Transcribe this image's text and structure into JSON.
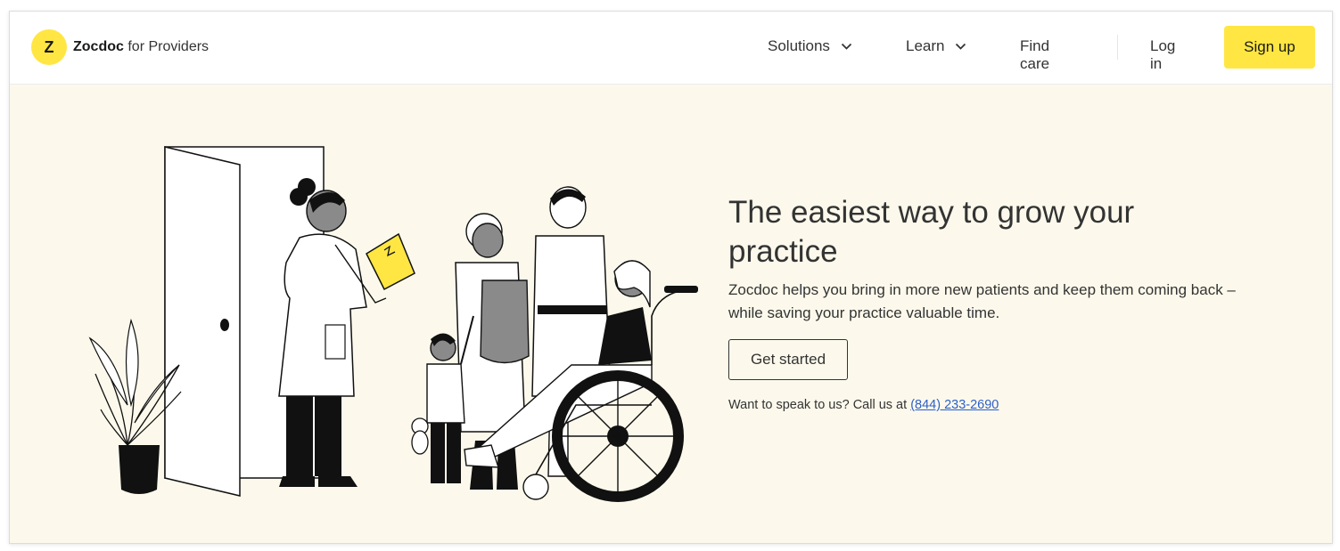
{
  "header": {
    "logo_glyph": "Z",
    "brand_name": "Zocdoc",
    "brand_suffix": "for Providers",
    "nav": {
      "solutions": "Solutions",
      "learn": "Learn",
      "find_care": "Find care",
      "log_in": "Log in",
      "sign_up": "Sign up"
    }
  },
  "hero": {
    "headline": "The easiest way to grow your practice",
    "subtext": "Zocdoc helps you bring in more new patients and keep them coming back – while saving your practice valuable time.",
    "cta_label": "Get started",
    "phone_prompt": "Want to speak to us? Call us at",
    "phone_number": "(844) 233-2690"
  },
  "colors": {
    "brand_yellow": "#ffe642",
    "hero_background": "#fcf9ec",
    "link_blue": "#2d5fc9",
    "text": "#333333"
  }
}
